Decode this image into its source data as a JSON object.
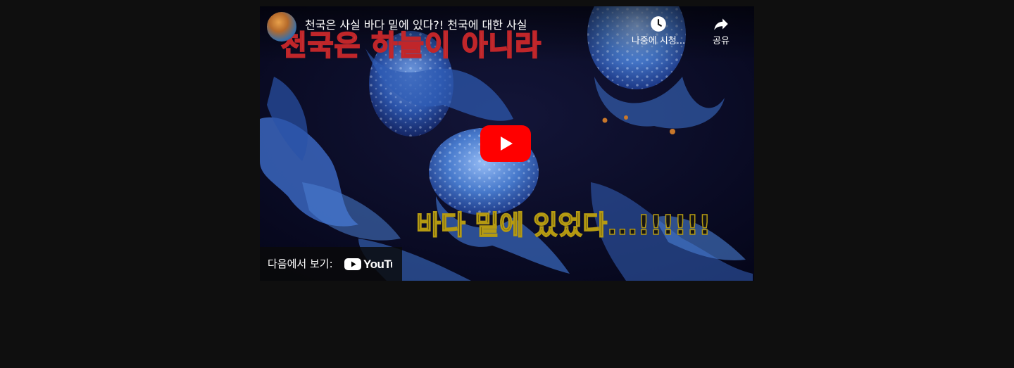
{
  "video": {
    "title": "천국은 사실 바다 밑에 있다?! 천국에 대한 사실",
    "headline_text": "천국은 하늘이 아니라",
    "caption_text": "바다 밑에 있었다...!!!!!!"
  },
  "actions": {
    "watch_later_label": "나중에 시청...",
    "share_label": "공유"
  },
  "watch_on": {
    "label": "다음에서 보기:",
    "brand": "YouTube"
  },
  "colors": {
    "page_background": "#0f0f0f",
    "play_button": "#ff0000",
    "headline_stroke": "#c0262a",
    "caption_stroke": "#b59a12",
    "jellyfish": "#4a7fd4"
  },
  "icons": {
    "watch_later": "clock-icon",
    "share": "share-arrow-icon",
    "play": "play-icon",
    "brand": "youtube-logo-icon"
  }
}
